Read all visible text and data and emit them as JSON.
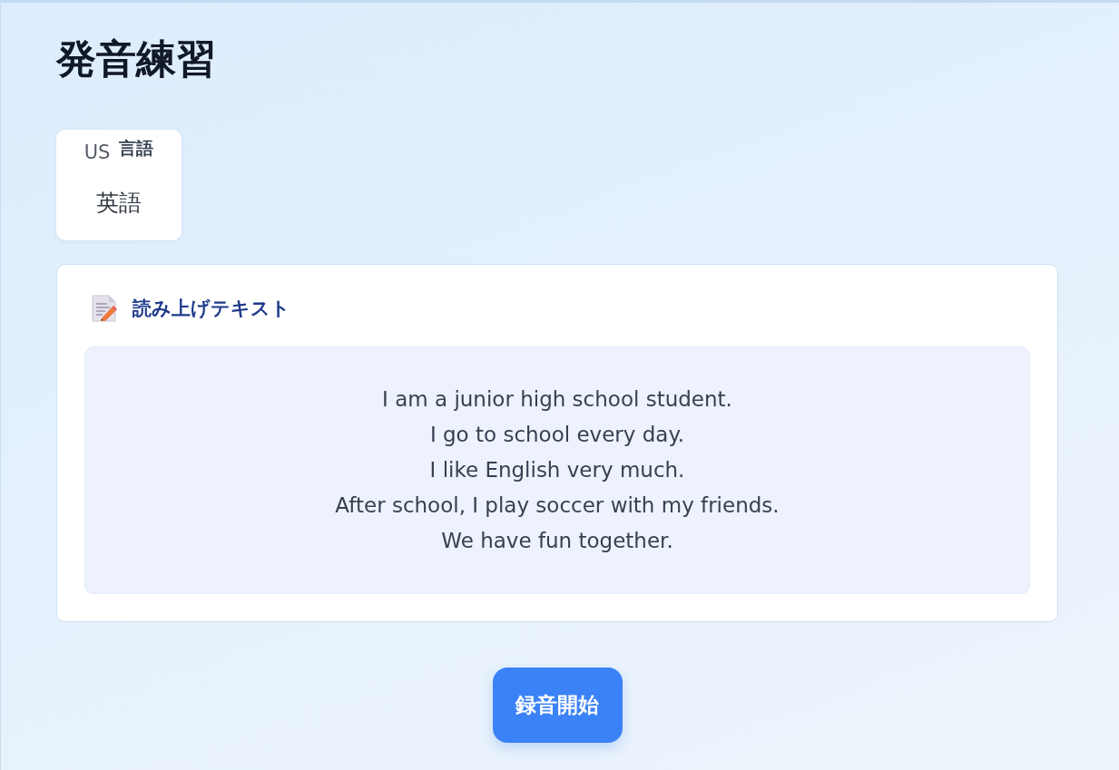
{
  "page": {
    "title": "発音練習"
  },
  "language_card": {
    "flag": "US",
    "label": "言語",
    "value": "英語"
  },
  "reading_panel": {
    "heading": "読み上げテキスト",
    "lines": [
      "I am a junior high school student.",
      "I go to school every day.",
      "I like English very much.",
      "After school, I play soccer with my friends.",
      "We have fun together."
    ]
  },
  "record_button": {
    "label": "録音開始"
  }
}
